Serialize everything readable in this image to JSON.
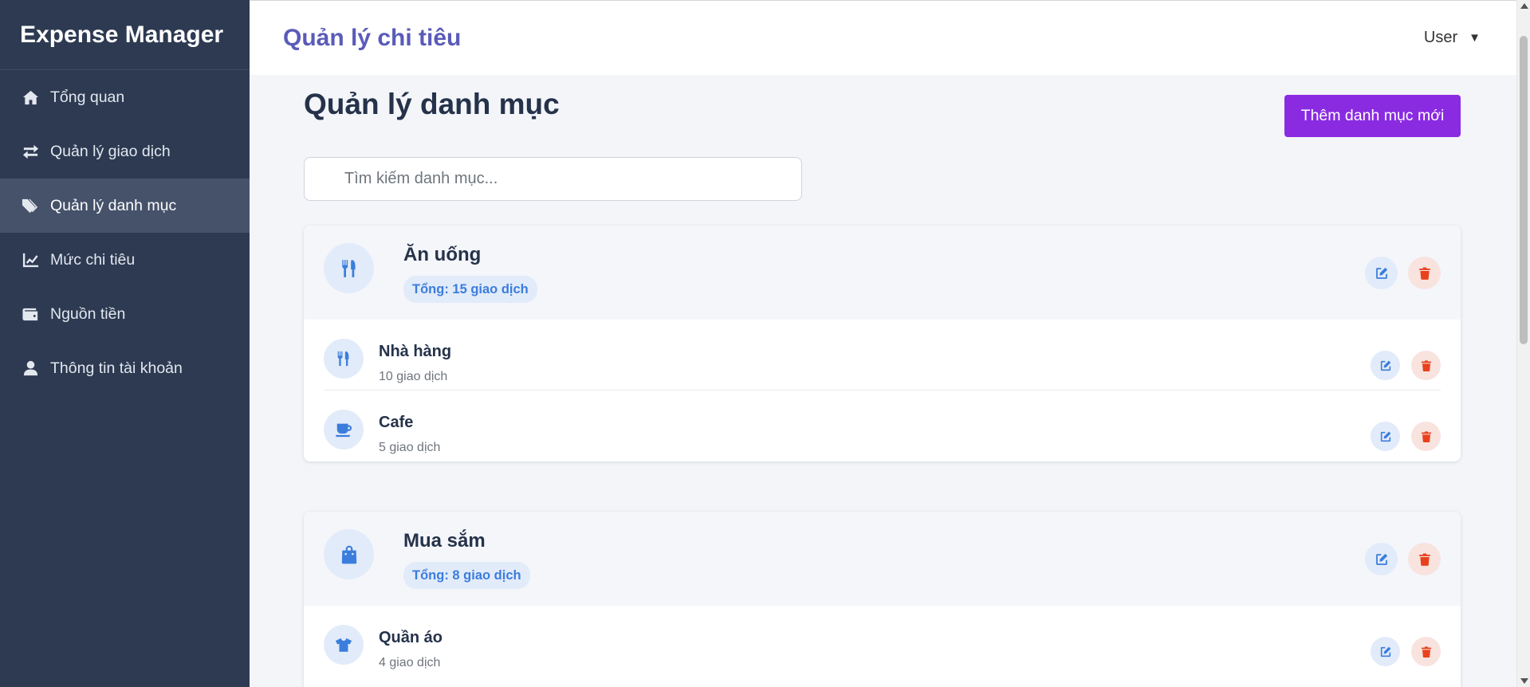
{
  "sidebar": {
    "brand": "Expense Manager",
    "items": [
      {
        "label": "Tổng quan",
        "icon": "home-icon"
      },
      {
        "label": "Quản lý giao dịch",
        "icon": "exchange-icon"
      },
      {
        "label": "Quản lý danh mục",
        "icon": "tags-icon",
        "active": true
      },
      {
        "label": "Mức chi tiêu",
        "icon": "chart-line-icon"
      },
      {
        "label": "Nguồn tiền",
        "icon": "wallet-icon"
      },
      {
        "label": "Thông tin tài khoản",
        "icon": "user-icon"
      }
    ]
  },
  "header": {
    "title": "Quản lý chi tiêu",
    "user_label": "User",
    "caret": "▼"
  },
  "main": {
    "page_title": "Quản lý danh mục",
    "add_button": "Thêm danh mục mới",
    "search_placeholder": "Tìm kiếm danh mục...",
    "categories": [
      {
        "name": "Ăn uống",
        "badge": "Tổng: 15 giao dịch",
        "icon": "utensils-icon",
        "subcategories": [
          {
            "name": "Nhà hàng",
            "count": "10 giao dịch",
            "icon": "utensils-icon"
          },
          {
            "name": "Cafe",
            "count": "5 giao dịch",
            "icon": "coffee-icon"
          }
        ]
      },
      {
        "name": "Mua sắm",
        "badge": "Tổng: 8 giao dịch",
        "icon": "shopping-bag-icon",
        "subcategories": [
          {
            "name": "Quần áo",
            "count": "4 giao dịch",
            "icon": "tshirt-icon"
          }
        ]
      }
    ]
  },
  "colors": {
    "sidebar_bg": "#2d3a52",
    "accent_purple": "#8a2be2",
    "title_blue": "#5a5bb8",
    "icon_blue": "#3b7ddd",
    "delete_red": "#e8421c"
  }
}
